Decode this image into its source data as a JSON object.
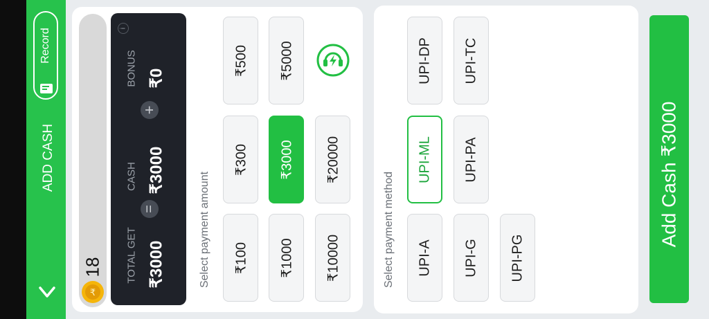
{
  "header": {
    "title": "ADD CASH",
    "record_label": "Record"
  },
  "balance": {
    "coins": "18"
  },
  "summary": {
    "total_label": "TOTAL GET",
    "total_value": "₹3000",
    "cash_label": "CASH",
    "cash_value": "₹3000",
    "bonus_label": "BONUS",
    "bonus_value": "₹0",
    "equals_symbol": "=",
    "plus_symbol": "+",
    "info_symbol": "i"
  },
  "amount_section": {
    "label": "Select payment amount",
    "amounts": [
      "₹100",
      "₹300",
      "₹500",
      "₹1000",
      "₹3000",
      "₹5000",
      "₹10000",
      "₹20000"
    ],
    "selected": "₹3000"
  },
  "method_section": {
    "label": "Select payment method",
    "methods": [
      "UPI-A",
      "UPI-ML",
      "UPI-DP",
      "UPI-G",
      "UPI-PA",
      "UPI-TC",
      "UPI-PG"
    ],
    "selected": "UPI-ML"
  },
  "cta": {
    "label": "Add Cash ₹3000"
  },
  "colors": {
    "accent": "#22bf43",
    "dark_panel": "#1f2229"
  },
  "icons": [
    "back-chevron-icon",
    "record-icon",
    "coin-icon",
    "info-icon",
    "equals-icon",
    "plus-icon",
    "support-headset-icon"
  ]
}
